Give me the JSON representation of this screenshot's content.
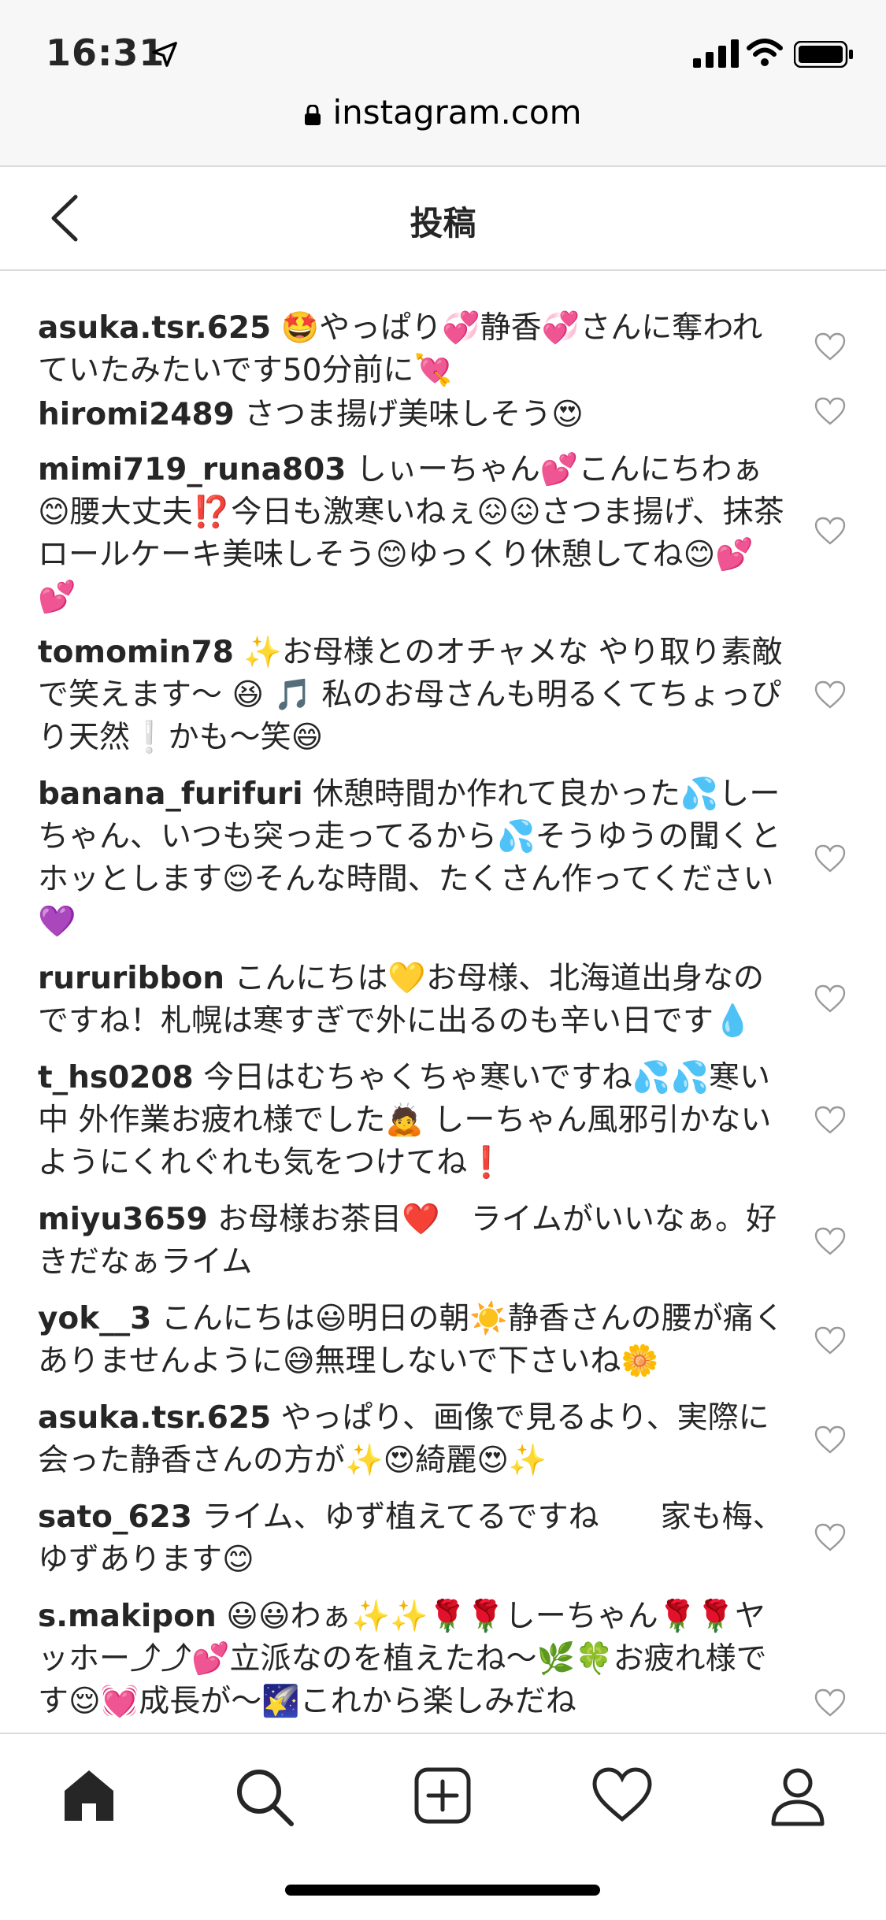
{
  "status_bar": {
    "time": "16:31"
  },
  "browser": {
    "url": "instagram.com"
  },
  "header": {
    "title": "投稿"
  },
  "comments": [
    {
      "user": "asuka.tsr.625",
      "text": "🤩やっぱり💞静香💞さんに奪われていたみたいです50分前に💘"
    },
    {
      "user": "hiromi2489",
      "text": "さつま揚げ美味しそう😍"
    },
    {
      "user": "mimi719_runa803",
      "text": "しぃーちゃん💕こんにちわぁ😊腰大丈夫⁉️今日も激寒いねぇ😖😖さつま揚げ、抹茶ロールケーキ美味しそう😊ゆっくり休憩してね😊💕💕"
    },
    {
      "user": "tomomin78",
      "text": "✨お母様とのオチャメな やり取り素敵で笑えます〜 😆 🎵 私のお母さんも明るくてちょっぴり天然❕かも〜笑😄"
    },
    {
      "user": "banana_furifuri",
      "text": "休憩時間か作れて良かった💦しーちゃん、いつも突っ走ってるから💦そうゆうの聞くとホッとします😌そんな時間、たくさん作ってください💜"
    },
    {
      "user": "rururibbon",
      "text": "こんにちは💛お母様、北海道出身なのですね！札幌は寒すぎで外に出るのも辛い日です💧"
    },
    {
      "user": "t_hs0208",
      "text": "今日はむちゃくちゃ寒いですね💦💦寒い中 外作業お疲れ様でした🙇 しーちゃん風邪引かないようにくれぐれも気をつけてね❗️"
    },
    {
      "user": "miyu3659",
      "text": "お母様お茶目❤️　ライムがいいなぁ。好きだなぁライム"
    },
    {
      "user": "yok__3",
      "text": "こんにちは😃明日の朝☀️静香さんの腰が痛くありませんように😅無理しないで下さいね🌼"
    },
    {
      "user": "asuka.tsr.625",
      "text": "やっぱり、画像で見るより、実際に会った静香さんの方が✨😍綺麗😍✨"
    },
    {
      "user": "sato_623",
      "text": "ライム、ゆず植えてるですね　　家も梅、ゆずあります😊"
    },
    {
      "user": "s.makipon",
      "text": "😃😃わぁ✨✨🌹🌹しーちゃん🌹🌹ヤッホー⤴︎⤴︎💕立派なのを植えたね〜🌿🍀お疲れ様です😌💓成長が〜🌠これから楽しみだね"
    }
  ],
  "nav": {
    "home": "home-icon",
    "search": "search-icon",
    "new_post": "plus-square-icon",
    "activity": "heart-icon",
    "profile": "profile-icon"
  }
}
